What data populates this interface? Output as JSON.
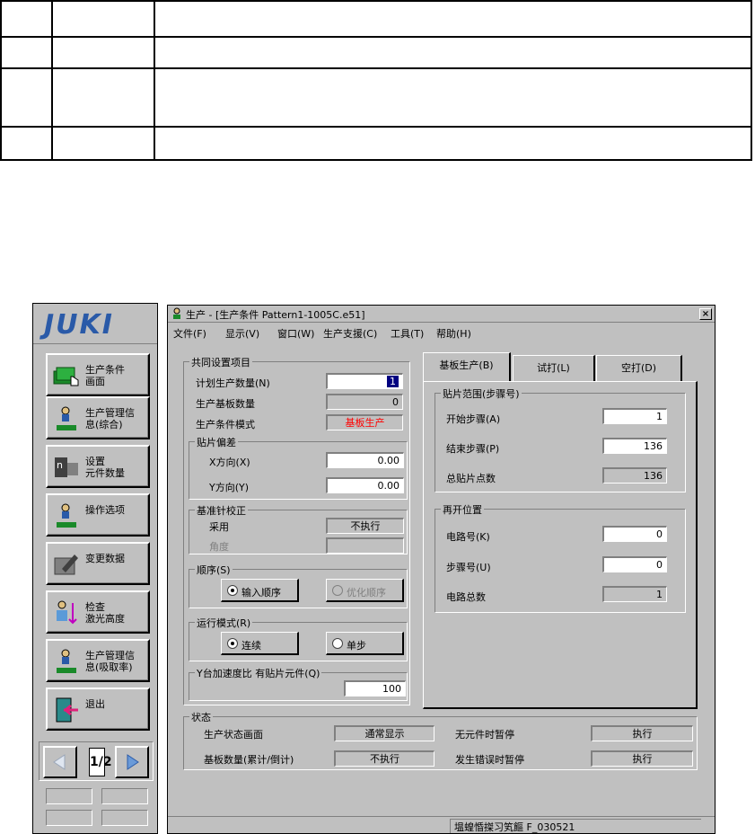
{
  "doc_table": {
    "rows": 4,
    "cols": 3
  },
  "left_panel": {
    "logo": "JUKI",
    "buttons": [
      {
        "label": "生产条件\n画面",
        "icon": "production-condition-icon"
      },
      {
        "label": "生产管理信\n息(综合)",
        "icon": "production-info-icon"
      },
      {
        "label": "设置\n元件数量",
        "icon": "set-parts-count-icon"
      },
      {
        "label": "操作选项",
        "icon": "operation-option-icon"
      },
      {
        "label": "变更数据",
        "icon": "change-data-icon"
      },
      {
        "label": "检查\n激光高度",
        "icon": "laser-height-icon"
      },
      {
        "label": "生产管理信\n息(吸取率)",
        "icon": "pickup-rate-icon"
      },
      {
        "label": "退出",
        "icon": "exit-icon"
      }
    ],
    "pager": {
      "page": "1/2"
    }
  },
  "window": {
    "title": "生产 - [生产条件 Pattern1-1005C.e51]",
    "close_label": "×",
    "menu": [
      "文件(F)",
      "显示(V)",
      "窗口(W)",
      "生产支援(C)",
      "工具(T)",
      "帮助(H)"
    ],
    "common": {
      "title": "共同设置项目",
      "plan_qty_label": "计划生产数量(N)",
      "plan_qty_value": "1",
      "produced_label": "生产基板数量",
      "produced_value": "0",
      "mode_label": "生产条件模式",
      "mode_value": "基板生产",
      "offset": {
        "title": "贴片偏差",
        "x_label": "X方向(X)",
        "x_value": "0.00",
        "y_label": "Y方向(Y)",
        "y_value": "0.00"
      },
      "pin": {
        "title": "基准针校正",
        "use_label": "采用",
        "use_value": "不执行",
        "angle_label": "角度",
        "angle_value": ""
      },
      "order": {
        "title": "顺序(S)",
        "opt1": "输入顺序",
        "opt2": "优化顺序"
      },
      "run": {
        "title": "运行模式(R)",
        "opt1": "连续",
        "opt2": "单步"
      },
      "accel": {
        "title": "Y台加速度比 有贴片元件(Q)",
        "value": "100"
      }
    },
    "tabs": [
      "基板生产(B)",
      "试打(L)",
      "空打(D)"
    ],
    "range": {
      "title": "贴片范围(步骤号)",
      "start_label": "开始步骤(A)",
      "start_value": "1",
      "end_label": "结束步骤(P)",
      "end_value": "136",
      "total_label": "总贴片点数",
      "total_value": "136"
    },
    "restart": {
      "title": "再开位置",
      "circuit_label": "电路号(K)",
      "circuit_value": "0",
      "step_label": "步骤号(U)",
      "step_value": "0",
      "circuit_total_label": "电路总数",
      "circuit_total_value": "1"
    },
    "status": {
      "title": "状态",
      "screen_label": "生产状态画面",
      "screen_value": "通常显示",
      "no_parts_label": "无元件时暂停",
      "no_parts_value": "执行",
      "board_count_label": "基板数量(累计/倒计)",
      "board_count_value": "不执行",
      "error_label": "发生错误时暂停",
      "error_value": "执行"
    },
    "statusbar_text": "塭蝗惛搩习笂饇  F_030521"
  },
  "colors": {
    "title_blue": "#2a5aa8",
    "highlight": "#000080",
    "mode_red": "#ff0000",
    "face": "#c0c0c0"
  }
}
